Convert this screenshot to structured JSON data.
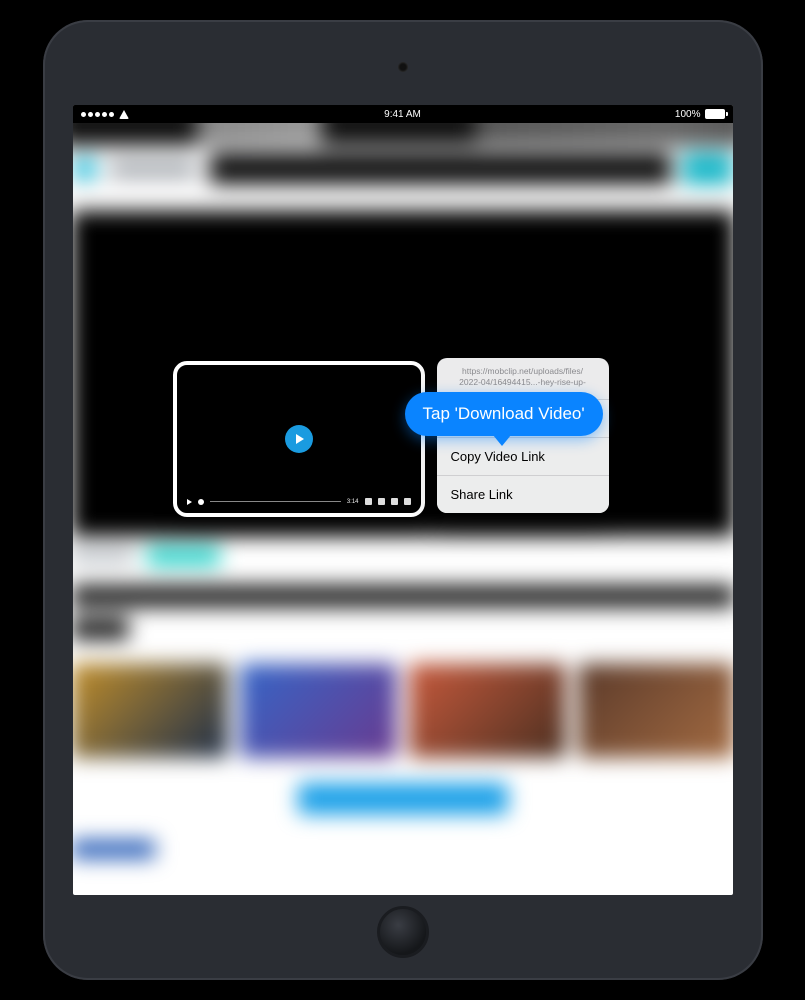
{
  "status_bar": {
    "time": "9:41 AM",
    "battery_pct": "100%"
  },
  "video_controls": {
    "time": "3:14"
  },
  "context_menu": {
    "url_line1": "https://mobclip.net/uploads/files/",
    "url_line2": "2022-04/16494415...-hey-rise-up-",
    "items": [
      "Download Video",
      "Copy Video Link",
      "Share Link"
    ]
  },
  "instruction": "Tap 'Download Video'"
}
